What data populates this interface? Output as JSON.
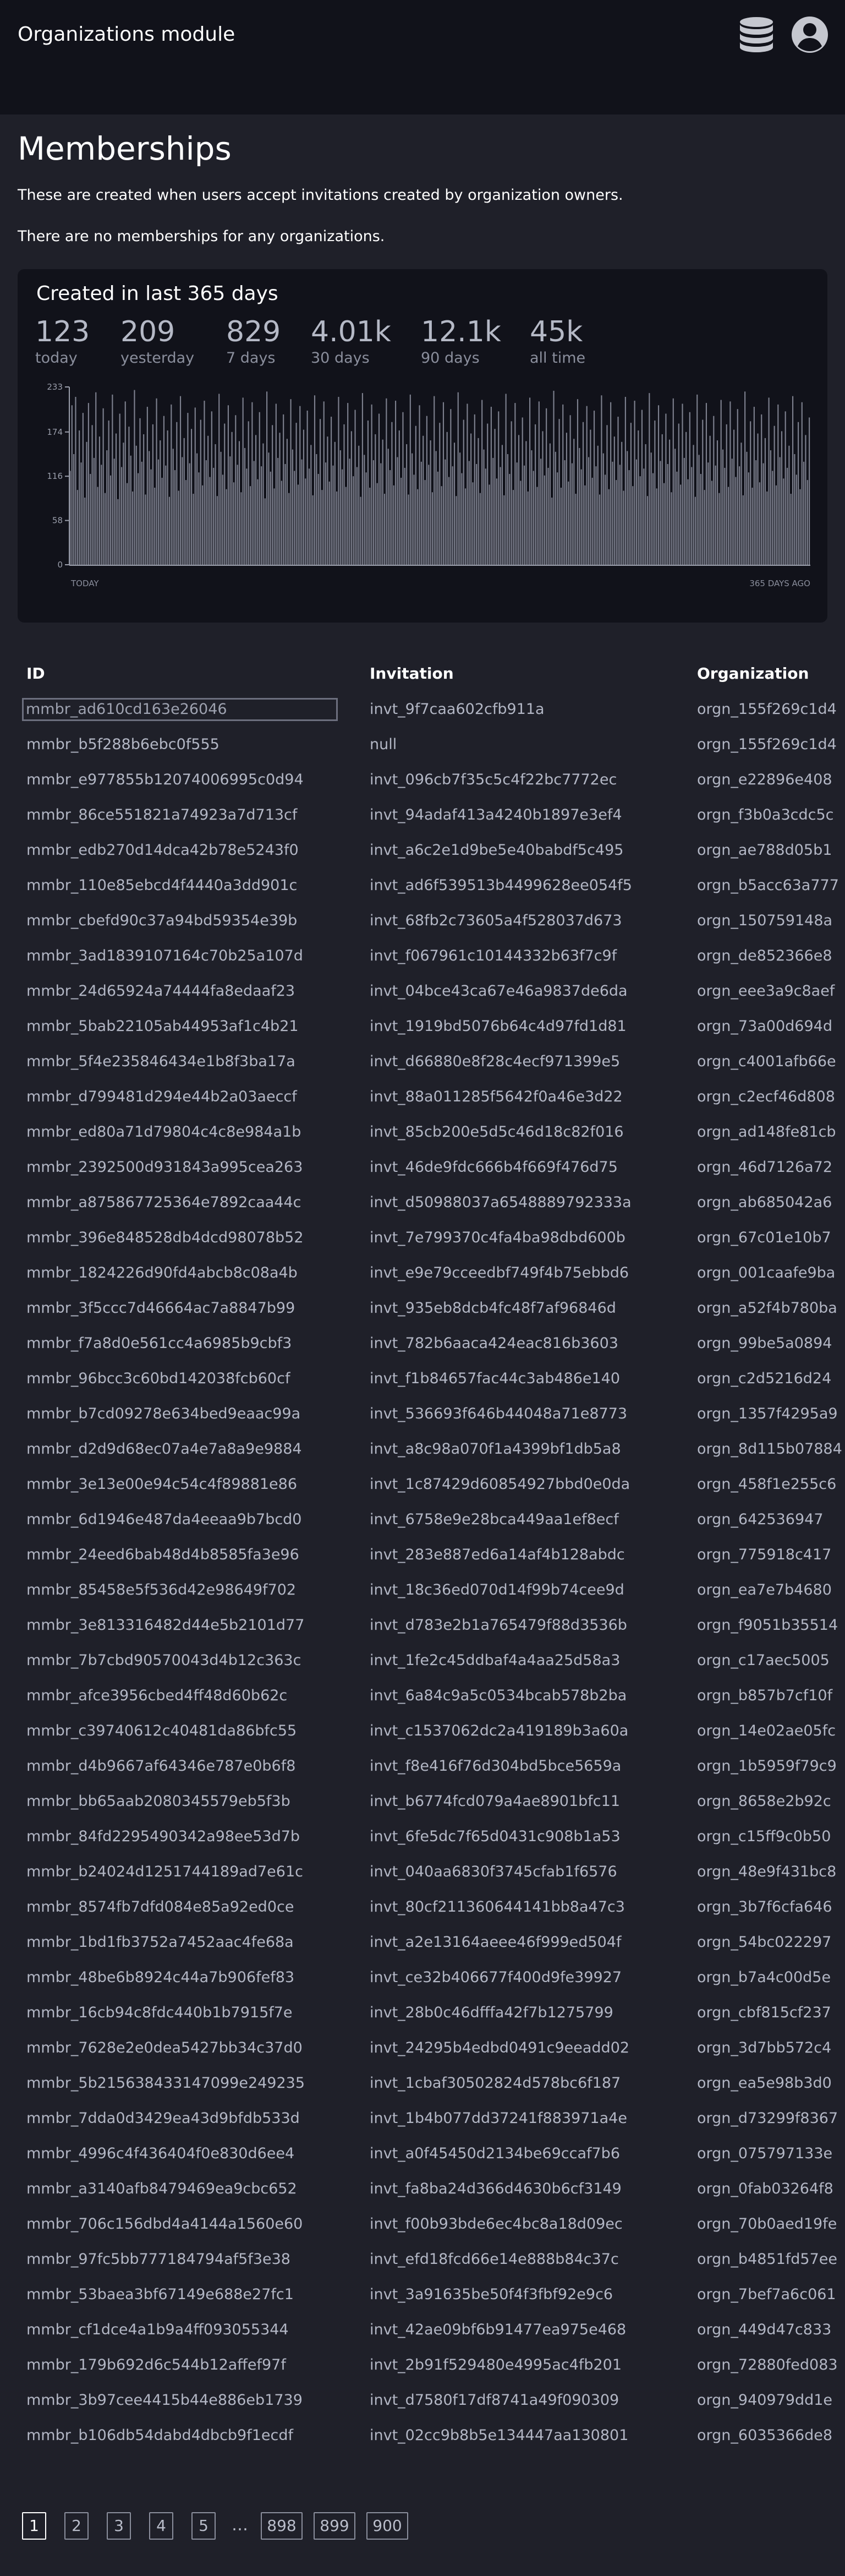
{
  "header": {
    "app_title": "Organizations module"
  },
  "page": {
    "title": "Memberships",
    "description": "These are created when users accept invitations created by organization owners.",
    "empty_message": "There are no memberships for any organizations."
  },
  "stats_card": {
    "title": "Created in last 365 days",
    "stats": [
      {
        "value": "123",
        "label": "today"
      },
      {
        "value": "209",
        "label": "yesterday"
      },
      {
        "value": "829",
        "label": "7 days"
      },
      {
        "value": "4.01k",
        "label": "30 days"
      },
      {
        "value": "12.1k",
        "label": "90 days"
      },
      {
        "value": "45k",
        "label": "all time"
      }
    ]
  },
  "chart_data": {
    "type": "bar",
    "yticks": [
      0,
      58,
      116,
      174,
      233
    ],
    "ylim": [
      0,
      233
    ],
    "x_start_label": "TODAY",
    "x_end_label": "365 DAYS AGO",
    "values": [
      123,
      209,
      145,
      220,
      98,
      176,
      134,
      199,
      88,
      161,
      212,
      119,
      183,
      140,
      226,
      102,
      168,
      131,
      205,
      94,
      150,
      189,
      117,
      223,
      139,
      172,
      86,
      198,
      128,
      160,
      214,
      107,
      181,
      143,
      96,
      229,
      156,
      120,
      192,
      135,
      171,
      92,
      207,
      149,
      125,
      184,
      101,
      218,
      138,
      163,
      114,
      195,
      130,
      176,
      89,
      210,
      152,
      124,
      187,
      97,
      221,
      141,
      166,
      111,
      199,
      133,
      178,
      93,
      206,
      146,
      121,
      190,
      104,
      215,
      137,
      169,
      115,
      201,
      127,
      158,
      90,
      224,
      148,
      118,
      185,
      99,
      209,
      142,
      174,
      108,
      196,
      131,
      162,
      95,
      219,
      153,
      126,
      188,
      103,
      213,
      136,
      170,
      112,
      200,
      129,
      159,
      87,
      227,
      147,
      122,
      183,
      100,
      211,
      140,
      173,
      110,
      197,
      132,
      165,
      94,
      217,
      151,
      123,
      186,
      105,
      208,
      138,
      177,
      113,
      202,
      126,
      157,
      91,
      222,
      145,
      119,
      191,
      98,
      214,
      134,
      168,
      109,
      194,
      130,
      161,
      96,
      220,
      150,
      125,
      184,
      102,
      212,
      139,
      175,
      116,
      203,
      128,
      156,
      89,
      225,
      144,
      121,
      189,
      101,
      210,
      137,
      171,
      107,
      198,
      133,
      164,
      93,
      218,
      152,
      124,
      187,
      104,
      215,
      141,
      176,
      114,
      200,
      127,
      158,
      92,
      223,
      146,
      118,
      182,
      99,
      209,
      135,
      169,
      111,
      195,
      131,
      163,
      95,
      221,
      149,
      122,
      186,
      103,
      213,
      138,
      174,
      115,
      204,
      129,
      160,
      90,
      226,
      147,
      120,
      190,
      100,
      211,
      136,
      172,
      108,
      197,
      132,
      166,
      94,
      216,
      151,
      126,
      185,
      105,
      207,
      140,
      178,
      113,
      201,
      128,
      157,
      91,
      224,
      145,
      119,
      188,
      98,
      212,
      134,
      170,
      110,
      193,
      130,
      162,
      96,
      219,
      150,
      123,
      184,
      102,
      214,
      139,
      175,
      117,
      205,
      127,
      159,
      88,
      228,
      148,
      121,
      191,
      101,
      210,
      137,
      173,
      109,
      196,
      133,
      165,
      93,
      217,
      153,
      125,
      187,
      104,
      208,
      141,
      177,
      114,
      202,
      129,
      156,
      92,
      222,
      146,
      118,
      183,
      99,
      213,
      135,
      168,
      111,
      194,
      131,
      161,
      97,
      220,
      149,
      124,
      186,
      103,
      215,
      138,
      176,
      116,
      203,
      126,
      158,
      90,
      225,
      147,
      120,
      189,
      100,
      209,
      136,
      171,
      107,
      198,
      132,
      164,
      95,
      218,
      152,
      122,
      185,
      105,
      211,
      140,
      174,
      112,
      200,
      128,
      157,
      89,
      223,
      144,
      119,
      190,
      98,
      212,
      134,
      169,
      110,
      195,
      130,
      163,
      94,
      216,
      151,
      127,
      184,
      102,
      214,
      139,
      177,
      115,
      204,
      129,
      160,
      91,
      227,
      148,
      121,
      188,
      101,
      207,
      137,
      172,
      108,
      197,
      133,
      166,
      96,
      219,
      150,
      123,
      182,
      104,
      210,
      141,
      175,
      113,
      201,
      127,
      156,
      93,
      221,
      145,
      118,
      187,
      99,
      213,
      135,
      170,
      111,
      193
    ]
  },
  "table": {
    "headers": [
      "ID",
      "Invitation",
      "Organization"
    ],
    "rows": [
      [
        "mmbr_ad610cd163e26046",
        "invt_9f7caa602cfb911a",
        "orgn_155f269c1d4"
      ],
      [
        "mmbr_b5f288b6ebc0f555",
        "null",
        "orgn_155f269c1d4"
      ],
      [
        "mmbr_e977855b12074006995c0d94",
        "invt_096cb7f35c5c4f22bc7772ec",
        "orgn_e22896e408"
      ],
      [
        "mmbr_86ce551821a74923a7d713cf",
        "invt_94adaf413a4240b1897e3ef4",
        "orgn_f3b0a3cdc5c"
      ],
      [
        "mmbr_edb270d14dca42b78e5243f0",
        "invt_a6c2e1d9be5e40babdf5c495",
        "orgn_ae788d05b1"
      ],
      [
        "mmbr_110e85ebcd4f4440a3dd901c",
        "invt_ad6f539513b4499628ee054f5",
        "orgn_b5acc63a777"
      ],
      [
        "mmbr_cbefd90c37a94bd59354e39b",
        "invt_68fb2c73605a4f528037d673",
        "orgn_150759148a"
      ],
      [
        "mmbr_3ad1839107164c70b25a107d",
        "invt_f067961c10144332b63f7c9f",
        "orgn_de852366e8"
      ],
      [
        "mmbr_24d65924a74444fa8edaaf23",
        "invt_04bce43ca67e46a9837de6da",
        "orgn_eee3a9c8aef"
      ],
      [
        "mmbr_5bab22105ab44953af1c4b21",
        "invt_1919bd5076b64c4d97fd1d81",
        "orgn_73a00d694d"
      ],
      [
        "mmbr_5f4e235846434e1b8f3ba17a",
        "invt_d66880e8f28c4ecf971399e5",
        "orgn_c4001afb66e"
      ],
      [
        "mmbr_d799481d294e44b2a03aeccf",
        "invt_88a011285f5642f0a46e3d22",
        "orgn_c2ecf46d808"
      ],
      [
        "mmbr_ed80a71d79804c4c8e984a1b",
        "invt_85cb200e5d5c46d18c82f016",
        "orgn_ad148fe81cb"
      ],
      [
        "mmbr_2392500d931843a995cea263",
        "invt_46de9fdc666b4f669f476d75",
        "orgn_46d7126a72"
      ],
      [
        "mmbr_a875867725364e7892caa44c",
        "invt_d50988037a6548889792333a",
        "orgn_ab685042a6"
      ],
      [
        "mmbr_396e848528db4dcd98078b52",
        "invt_7e799370c4fa4ba98dbd600b",
        "orgn_67c01e10b7"
      ],
      [
        "mmbr_1824226d90fd4abcb8c08a4b",
        "invt_e9e79cceedbf749f4b75ebbd6",
        "orgn_001caafe9ba"
      ],
      [
        "mmbr_3f5ccc7d46664ac7a8847b99",
        "invt_935eb8dcb4fc48f7af96846d",
        "orgn_a52f4b780ba"
      ],
      [
        "mmbr_f7a8d0e561cc4a6985b9cbf3",
        "invt_782b6aaca424eac816b3603",
        "orgn_99be5a0894"
      ],
      [
        "mmbr_96bcc3c60bd142038fcb60cf",
        "invt_f1b84657fac44c3ab486e140",
        "orgn_c2d5216d24"
      ],
      [
        "mmbr_b7cd09278e634bed9eaac99a",
        "invt_536693f646b44048a71e8773",
        "orgn_1357f4295a9"
      ],
      [
        "mmbr_d2d9d68ec07a4e7a8a9e9884",
        "invt_a8c98a070f1a4399bf1db5a8",
        "orgn_8d115b07884"
      ],
      [
        "mmbr_3e13e00e94c54c4f89881e86",
        "invt_1c87429d60854927bbd0e0da",
        "orgn_458f1e255c6"
      ],
      [
        "mmbr_6d1946e487da4eeaa9b7bcd0",
        "invt_6758e9e28bca449aa1ef8ecf",
        "orgn_642536947"
      ],
      [
        "mmbr_24eed6bab48d4b8585fa3e96",
        "invt_283e887ed6a14af4b128abdc",
        "orgn_775918c417"
      ],
      [
        "mmbr_85458e5f536d42e98649f702",
        "invt_18c36ed070d14f99b74cee9d",
        "orgn_ea7e7b4680"
      ],
      [
        "mmbr_3e813316482d44e5b2101d77",
        "invt_d783e2b1a765479f88d3536b",
        "orgn_f9051b35514"
      ],
      [
        "mmbr_7b7cbd90570043d4b12c363c",
        "invt_1fe2c45ddbaf4a4aa25d58a3",
        "orgn_c17aec5005"
      ],
      [
        "mmbr_afce3956cbed4ff48d60b62c",
        "invt_6a84c9a5c0534bcab578b2ba",
        "orgn_b857b7cf10f"
      ],
      [
        "mmbr_c39740612c40481da86bfc55",
        "invt_c1537062dc2a419189b3a60a",
        "orgn_14e02ae05fc"
      ],
      [
        "mmbr_d4b9667af64346e787e0b6f8",
        "invt_f8e416f76d304bd5bce5659a",
        "orgn_1b5959f79c9"
      ],
      [
        "mmbr_bb65aab2080345579eb5f3b",
        "invt_b6774fcd079a4ae8901bfc11",
        "orgn_8658e2b92c"
      ],
      [
        "mmbr_84fd2295490342a98ee53d7b",
        "invt_6fe5dc7f65d0431c908b1a53",
        "orgn_c15ff9c0b50"
      ],
      [
        "mmbr_b24024d1251744189ad7e61c",
        "invt_040aa6830f3745cfab1f6576",
        "orgn_48e9f431bc8"
      ],
      [
        "mmbr_8574fb7dfd084e85a92ed0ce",
        "invt_80cf211360644141bb8a47c3",
        "orgn_3b7f6cfa646"
      ],
      [
        "mmbr_1bd1fb3752a7452aac4fe68a",
        "invt_a2e13164aeee46f999ed504f",
        "orgn_54bc022297"
      ],
      [
        "mmbr_48be6b8924c44a7b906fef83",
        "invt_ce32b406677f400d9fe39927",
        "orgn_b7a4c00d5e"
      ],
      [
        "mmbr_16cb94c8fdc440b1b7915f7e",
        "invt_28b0c46dfffa42f7b1275799",
        "orgn_cbf815cf237"
      ],
      [
        "mmbr_7628e2e0dea5427bb34c37d0",
        "invt_24295b4edbd0491c9eeadd02",
        "orgn_3d7bb572c4"
      ],
      [
        "mmbr_5b215638433147099e249235",
        "invt_1cbaf30502824d578bc6f187",
        "orgn_ea5e98b3d0"
      ],
      [
        "mmbr_7dda0d3429ea43d9bfdb533d",
        "invt_1b4b077dd37241f883971a4e",
        "orgn_d73299f8367"
      ],
      [
        "mmbr_4996c4f436404f0e830d6ee4",
        "invt_a0f45450d2134be69ccaf7b6",
        "orgn_075797133e"
      ],
      [
        "mmbr_a3140afb8479469ea9cbc652",
        "invt_fa8ba24d366d4630b6cf3149",
        "orgn_0fab03264f8"
      ],
      [
        "mmbr_706c156dbd4a4144a1560e60",
        "invt_f00b93bde6ec4bc8a18d09ec",
        "orgn_70b0aed19fe"
      ],
      [
        "mmbr_97fc5bb777184794af5f3e38",
        "invt_efd18fcd66e14e888b84c37c",
        "orgn_b4851fd57ee"
      ],
      [
        "mmbr_53baea3bf67149e688e27fc1",
        "invt_3a91635be50f4f3fbf92e9c6",
        "orgn_7bef7a6c061"
      ],
      [
        "mmbr_cf1dce4a1b9a4ff093055344",
        "invt_42ae09bf6b91477ea975e468",
        "orgn_449d47c833"
      ],
      [
        "mmbr_179b692d6c544b12affef97f",
        "invt_2b91f529480e4995ac4fb201",
        "orgn_72880fed083"
      ],
      [
        "mmbr_3b97cee4415b44e886eb1739",
        "invt_d7580f17df8741a49f090309",
        "orgn_940979dd1e"
      ],
      [
        "mmbr_b106db54dabd4dbcb9f1ecdf",
        "invt_02cc9b8b5e134447aa130801",
        "orgn_6035366de8"
      ]
    ]
  },
  "pagination": {
    "pages": [
      "1",
      "2",
      "3",
      "4",
      "5"
    ],
    "ellipsis": "…",
    "last_pages": [
      "898",
      "899",
      "900"
    ],
    "current": "1"
  },
  "colors": {
    "page_bg": "#1f2029",
    "topbar_bg": "#11121a",
    "card_bg": "#11121a",
    "bar": "#7d808e",
    "text_muted": "#b2b6c4"
  }
}
